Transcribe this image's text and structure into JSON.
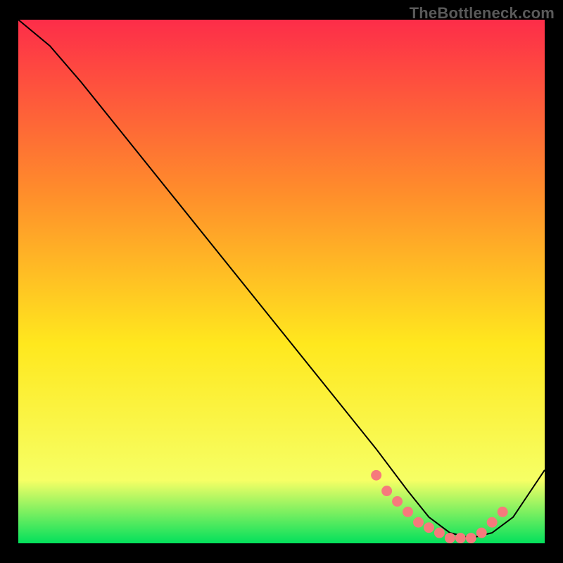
{
  "watermark": "TheBottleneck.com",
  "chart_data": {
    "type": "line",
    "title": "",
    "xlabel": "",
    "ylabel": "",
    "xlim": [
      0,
      100
    ],
    "ylim": [
      0,
      100
    ],
    "grid": false,
    "legend": false,
    "background_gradient": {
      "top": "#fd2d49",
      "upper_mid": "#ff8d2b",
      "mid": "#ffe81e",
      "lower_mid": "#f6ff65",
      "bottom": "#03e05c"
    },
    "series": [
      {
        "name": "bottleneck-curve",
        "stroke": "#000000",
        "x": [
          0,
          6,
          12,
          20,
          28,
          36,
          44,
          52,
          60,
          68,
          74,
          78,
          82,
          86,
          90,
          94,
          100
        ],
        "y": [
          100,
          95,
          88,
          78,
          68,
          58,
          48,
          38,
          28,
          18,
          10,
          5,
          2,
          1,
          2,
          5,
          14
        ]
      }
    ],
    "markers": {
      "name": "optimal-range",
      "color": "#f67a7c",
      "x": [
        68,
        70,
        72,
        74,
        76,
        78,
        80,
        82,
        84,
        86,
        88,
        90,
        92
      ],
      "y": [
        13,
        10,
        8,
        6,
        4,
        3,
        2,
        1,
        1,
        1,
        2,
        4,
        6
      ]
    }
  }
}
